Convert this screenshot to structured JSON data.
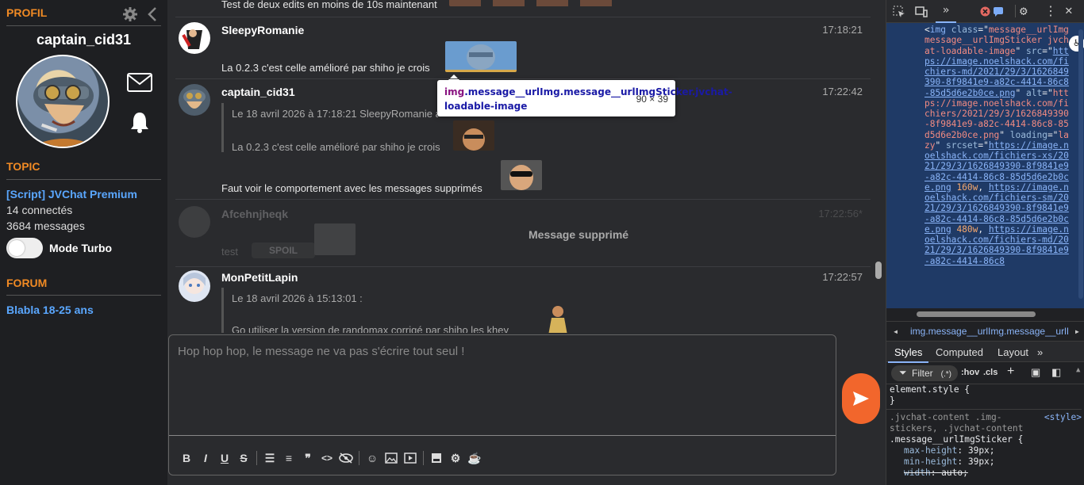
{
  "sidebar": {
    "profile_title": "PROFIL",
    "username": "captain_cid31",
    "topic_title": "TOPIC",
    "topic_link": "[Script] JVChat Premium",
    "connected": "14 connectés",
    "messages_count": "3684 messages",
    "mode_turbo": "Mode Turbo",
    "forum_title": "FORUM",
    "forum_link": "Blabla 18-25 ans"
  },
  "chat": {
    "top_partial_text": "Test de deux edits en moins de 10s maintenant",
    "messages": [
      {
        "author": "SleepyRomanie",
        "time": "17:18:21",
        "text": "La 0.2.3 c'est celle amélioré par shiho je crois"
      },
      {
        "author": "captain_cid31",
        "time": "17:22:42",
        "quote_header": "Le 18 avril 2026 à 17:18:21 SleepyRomanie a écrit :",
        "quote_text": "La 0.2.3 c'est celle amélioré par shiho je crois",
        "text": "Faut voir le comportement avec les messages supprimés"
      },
      {
        "author": "Afcehnjheqk",
        "time": "17:22:56*",
        "text": "test",
        "spoil": "SPOIL",
        "deleted_label": "Message supprimé"
      },
      {
        "author": "MonPetitLapin",
        "time": "17:22:57",
        "quote_header": "Le 18 avril 2026 à 15:13:01 :",
        "quote_text": "Go utiliser la version de randomax corrigé par shiho les khey"
      }
    ],
    "tooltip": {
      "tag": "img",
      "class_text": ".message__urlImg.message__urlImgSticker.jvchat-loadable-image",
      "size": "90 × 39"
    }
  },
  "composer": {
    "placeholder": "Hop hop hop, le message ne va pas s'écrire tout seul !"
  },
  "devtools": {
    "breadcrumb": "img.message__urlImg.message__urlImgSticker",
    "tabs": {
      "styles": "Styles",
      "computed": "Computed",
      "layout": "Layout"
    },
    "filter_label": "Filter",
    "filter_hov": ":hov",
    "filter_cls": ".cls",
    "element_style": "element.style {",
    "close_brace": "}",
    "selector_line1": ".jvchat-content .img-",
    "selector_line2": "stickers, .jvchat-content",
    "selector_line3": ".message__urlImgSticker {",
    "source_link": "<style>",
    "prop1": "max-height",
    "val1": "39px;",
    "prop2": "min-height",
    "val2": "39px;",
    "prop3": "width",
    "val3": "auto;"
  },
  "colors": {
    "accent": "#f08a24",
    "link": "#5aa7ff",
    "send": "#f2662c"
  }
}
